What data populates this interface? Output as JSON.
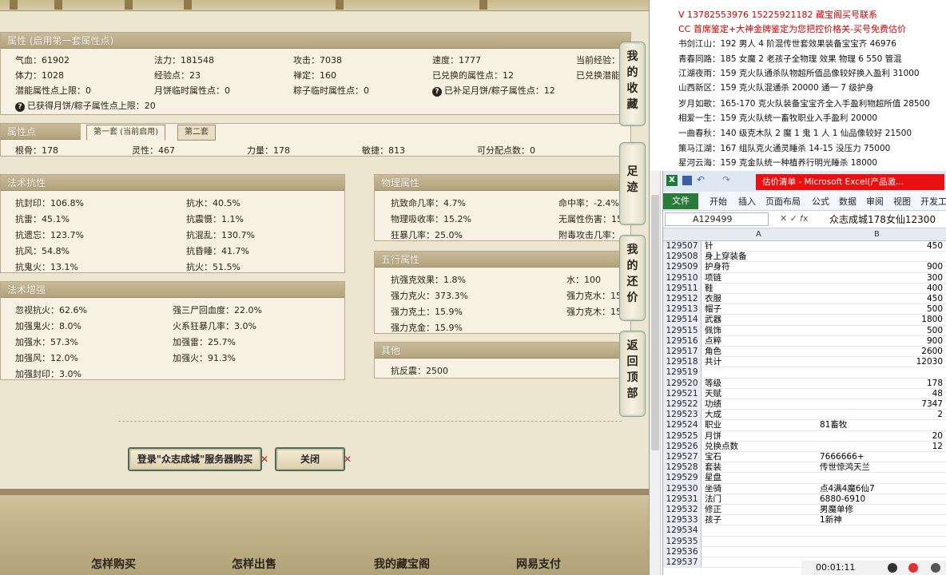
{
  "attr_panel": {
    "title": "属性 (启用第一套属性点)",
    "rows": [
      [
        "气血：61902",
        "法力：181548",
        "攻击：7038",
        "速度：1777",
        "当前经验："
      ],
      [
        "体力：1028",
        "经验点：23",
        "禅定：160",
        "已兑换的属性点：12",
        "已兑换潜能"
      ],
      [
        "潜能属性点上限：0",
        "月饼临时属性点：0",
        "粽子临时属性点：0",
        "已补足月饼/粽子属性点：12",
        ""
      ]
    ],
    "note": "已获得月饼/粽子属性点上限：20"
  },
  "points_panel": {
    "title": "属性点",
    "tabs": [
      "第一套 (当前启用)",
      "第二套"
    ],
    "values": [
      "根骨：178",
      "灵性：467",
      "力量：178",
      "敏捷：813",
      "可分配点数：0"
    ]
  },
  "resist_panel": {
    "title": "法术抗性",
    "left": [
      "抗封印：106.8%",
      "抗雷：45.1%",
      "抗遗忘：123.7%",
      "抗风：54.8%",
      "抗鬼火：13.1%"
    ],
    "right": [
      "抗水：40.5%",
      "抗震慑：1.1%",
      "抗混乱：130.7%",
      "抗昏睡：41.7%",
      "抗火：51.5%"
    ]
  },
  "enhance_panel": {
    "title": "法术增强",
    "left": [
      "忽视抗火：62.6%",
      "加强鬼火：8.0%",
      "加强水：57.3%",
      "加强风：12.0%",
      "加强封印：3.0%"
    ],
    "right": [
      "强三尸回血度：22.0%",
      "火系狂暴几率：3.0%",
      "加强雷：25.7%",
      "加强火：91.3%"
    ]
  },
  "phys_panel": {
    "title": "物理属性",
    "left": [
      "抗致命几率：4.7%",
      "物理吸收率：15.2%",
      "狂暴几率：25.0%"
    ],
    "right": [
      "命中率：-2.4%",
      "无属性伤害：15",
      "附毒攻击几率："
    ]
  },
  "five_panel": {
    "title": "五行属性",
    "left": [
      "抗强克效果：1.8%",
      "强力克火：373.3%",
      "强力克土：15.9%",
      "强力克金：15.9%"
    ],
    "right": [
      "水：100",
      "强力克水：15",
      "强力克木：15"
    ]
  },
  "other_panel": {
    "title": "其他",
    "values": [
      "抗反震：2500"
    ]
  },
  "buttons": {
    "login": "登录\"众志成城\"服务器购买",
    "close": "关闭"
  },
  "side_nav": [
    "我的收藏",
    "足迹",
    "我的还价",
    "返回顶部"
  ],
  "footer_links": [
    "怎样购买",
    "怎样出售",
    "我的藏宝阁",
    "网易支付"
  ],
  "notes": {
    "contact": "V 13782553976    15225921182   藏宝阁买号联系",
    "promo": "CC 首席鉴定+大神金牌鉴定为您把控价格关-买号免费估价",
    "lines": [
      "书剑江山：192 男人 4 阶混传世套效果装备宝宝齐 46976",
      "青春同路：185 女魔 2 老孩子全物理 效果 物理 6 550 管混",
      "江湖夜雨：159 克火队通杀队物超所值品像较好换入盈利 31000",
      "山西新区：159 克火队混通杀 20000 通一 7 级护身",
      "岁月如歌：165-170 克火队装备宝宝齐全入手盈利物超所值 28500",
      "相爱一生：159 克火队统一畜牧职业入手盈利 20000",
      "一曲春秋：140 级克木队 2 魔 1 鬼 1 人 1 仙品像较好 21500",
      "策马江湖：167 组队克火通灵睡杀 14-15 没压力 75000",
      "星河云海：159 克金队统一种植养行明光睡杀 18000"
    ]
  },
  "excel": {
    "title": "估价清单 - Microsoft Excel(产品激...",
    "ribbon_file": "文件",
    "ribbon_tabs": [
      "开始",
      "插入",
      "页面布局",
      "公式",
      "数据",
      "审阅",
      "视图",
      "开发工"
    ],
    "name_box": "A129499",
    "formula": "众志成城178女仙12300",
    "col_a": "A",
    "col_b": "B",
    "rows": [
      [
        "129507",
        "针",
        "450"
      ],
      [
        "129508",
        "身上穿装备",
        ""
      ],
      [
        "129509",
        "护身符",
        "900"
      ],
      [
        "129510",
        "项链",
        "300"
      ],
      [
        "129511",
        "鞋",
        "400"
      ],
      [
        "129512",
        "衣服",
        "450"
      ],
      [
        "129513",
        "帽子",
        "500"
      ],
      [
        "129514",
        "武器",
        "1800"
      ],
      [
        "129515",
        "佩饰",
        "500"
      ],
      [
        "129516",
        "点粹",
        "900"
      ],
      [
        "129517",
        "角色",
        "2600"
      ],
      [
        "129518",
        "共计",
        "12030"
      ],
      [
        "129519",
        "",
        ""
      ],
      [
        "129520",
        "等级",
        "178"
      ],
      [
        "129521",
        "天赋",
        "48"
      ],
      [
        "129522",
        "功绩",
        "7347"
      ],
      [
        "129523",
        "大成",
        "2"
      ],
      [
        "129524",
        "职业",
        "81畜牧"
      ],
      [
        "129525",
        "月饼",
        "20"
      ],
      [
        "129526",
        "兑换点数",
        "12"
      ],
      [
        "129527",
        "宝石",
        "7666666+"
      ],
      [
        "129528",
        "套装",
        "传世惊鸿天兰"
      ],
      [
        "129529",
        "星盘",
        ""
      ],
      [
        "129530",
        "坐骑",
        "点4满4魔6仙7"
      ],
      [
        "129531",
        "法门",
        "6880-6910"
      ],
      [
        "129532",
        "修正",
        "男魔单修"
      ],
      [
        "129533",
        "孩子",
        "1新神"
      ],
      [
        "129534",
        "",
        ""
      ],
      [
        "129535",
        "",
        ""
      ],
      [
        "129536",
        "",
        ""
      ],
      [
        "129537",
        "",
        ""
      ]
    ],
    "text_cells": [
      17,
      20,
      21,
      23,
      24,
      25,
      26
    ],
    "timer": "00:01:11"
  }
}
